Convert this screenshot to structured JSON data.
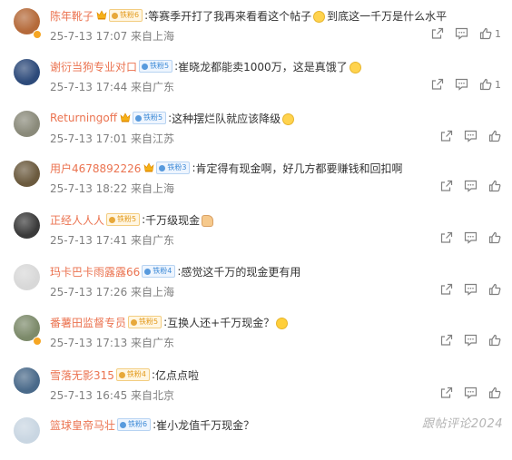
{
  "comments": [
    {
      "name": "陈年靴子",
      "crown": true,
      "badge": "铁粉6",
      "badge_type": "gold",
      "sep": ":",
      "text": "等赛季开打了我再来看看这个帖子",
      "emoji": "smile",
      "text2": "到底这一千万是什么水平",
      "meta": "25-7-13 17:07 来自上海",
      "likes": "1",
      "avatar_color": "#b56a3a",
      "vip": true
    },
    {
      "name": "谢衍当狗专业对口",
      "crown": false,
      "badge": "铁粉5",
      "badge_type": "blue",
      "sep": ":",
      "text": "崔晓龙都能卖1000万，这是真饿了",
      "emoji": "smile",
      "text2": "",
      "meta": "25-7-13 17:44 来自广东",
      "likes": "1",
      "avatar_color": "#2d4a7a",
      "vip": false
    },
    {
      "name": "Returningoff",
      "crown": true,
      "badge": "铁粉5",
      "badge_type": "blue",
      "sep": ":",
      "text": "这种摆烂队就应该降级",
      "emoji": "smile",
      "text2": "",
      "meta": "25-7-13 17:01 来自江苏",
      "likes": "",
      "avatar_color": "#8a8a7a",
      "vip": false
    },
    {
      "name": "用户4678892226",
      "crown": true,
      "badge": "铁粉3",
      "badge_type": "blue",
      "sep": ":",
      "text": "肯定得有现金啊，好几方都要赚钱和回扣啊",
      "emoji": "",
      "text2": "",
      "meta": "25-7-13 18:22 来自上海",
      "likes": "",
      "avatar_color": "#6b5a3e",
      "vip": false
    },
    {
      "name": "正经人人人",
      "crown": false,
      "badge": "铁粉5",
      "badge_type": "gold",
      "sep": ":",
      "text": "千万级现金",
      "emoji": "hand",
      "text2": "",
      "meta": "25-7-13 17:41 来自广东",
      "likes": "",
      "avatar_color": "#3a3a3a",
      "vip": false
    },
    {
      "name": "玛卡巴卡雨露露66",
      "crown": false,
      "badge": "铁粉4",
      "badge_type": "blue",
      "sep": ":",
      "text": "感觉这千万的现金更有用",
      "emoji": "",
      "text2": "",
      "meta": "25-7-13 17:26 来自上海",
      "likes": "",
      "avatar_color": "#d8d8d8",
      "vip": false
    },
    {
      "name": "番薯田监督专员",
      "crown": false,
      "badge": "铁粉5",
      "badge_type": "gold",
      "sep": ":",
      "text": "互换人还+千万现金？",
      "emoji": "wow",
      "text2": "",
      "meta": "25-7-13 17:13 来自广东",
      "likes": "",
      "avatar_color": "#7c8a6a",
      "vip": true
    },
    {
      "name": "雪落无影315",
      "crown": false,
      "badge": "铁粉4",
      "badge_type": "gold",
      "sep": ":",
      "text": "亿点点啦",
      "emoji": "",
      "text2": "",
      "meta": "25-7-13 16:45 来自北京",
      "likes": "",
      "avatar_color": "#4a6a8a",
      "vip": false
    },
    {
      "name": "篮球皇帝马壮",
      "crown": false,
      "badge": "铁粉6",
      "badge_type": "blue",
      "sep": ":",
      "text": "崔小龙值千万现金？",
      "emoji": "",
      "text2": "",
      "meta": "",
      "likes": "",
      "avatar_color": "#c9d6e2",
      "vip": false
    }
  ],
  "watermark": "跟帖评论2024",
  "icons": {
    "share": "share-icon",
    "comment": "comment-icon",
    "like": "like-icon"
  }
}
